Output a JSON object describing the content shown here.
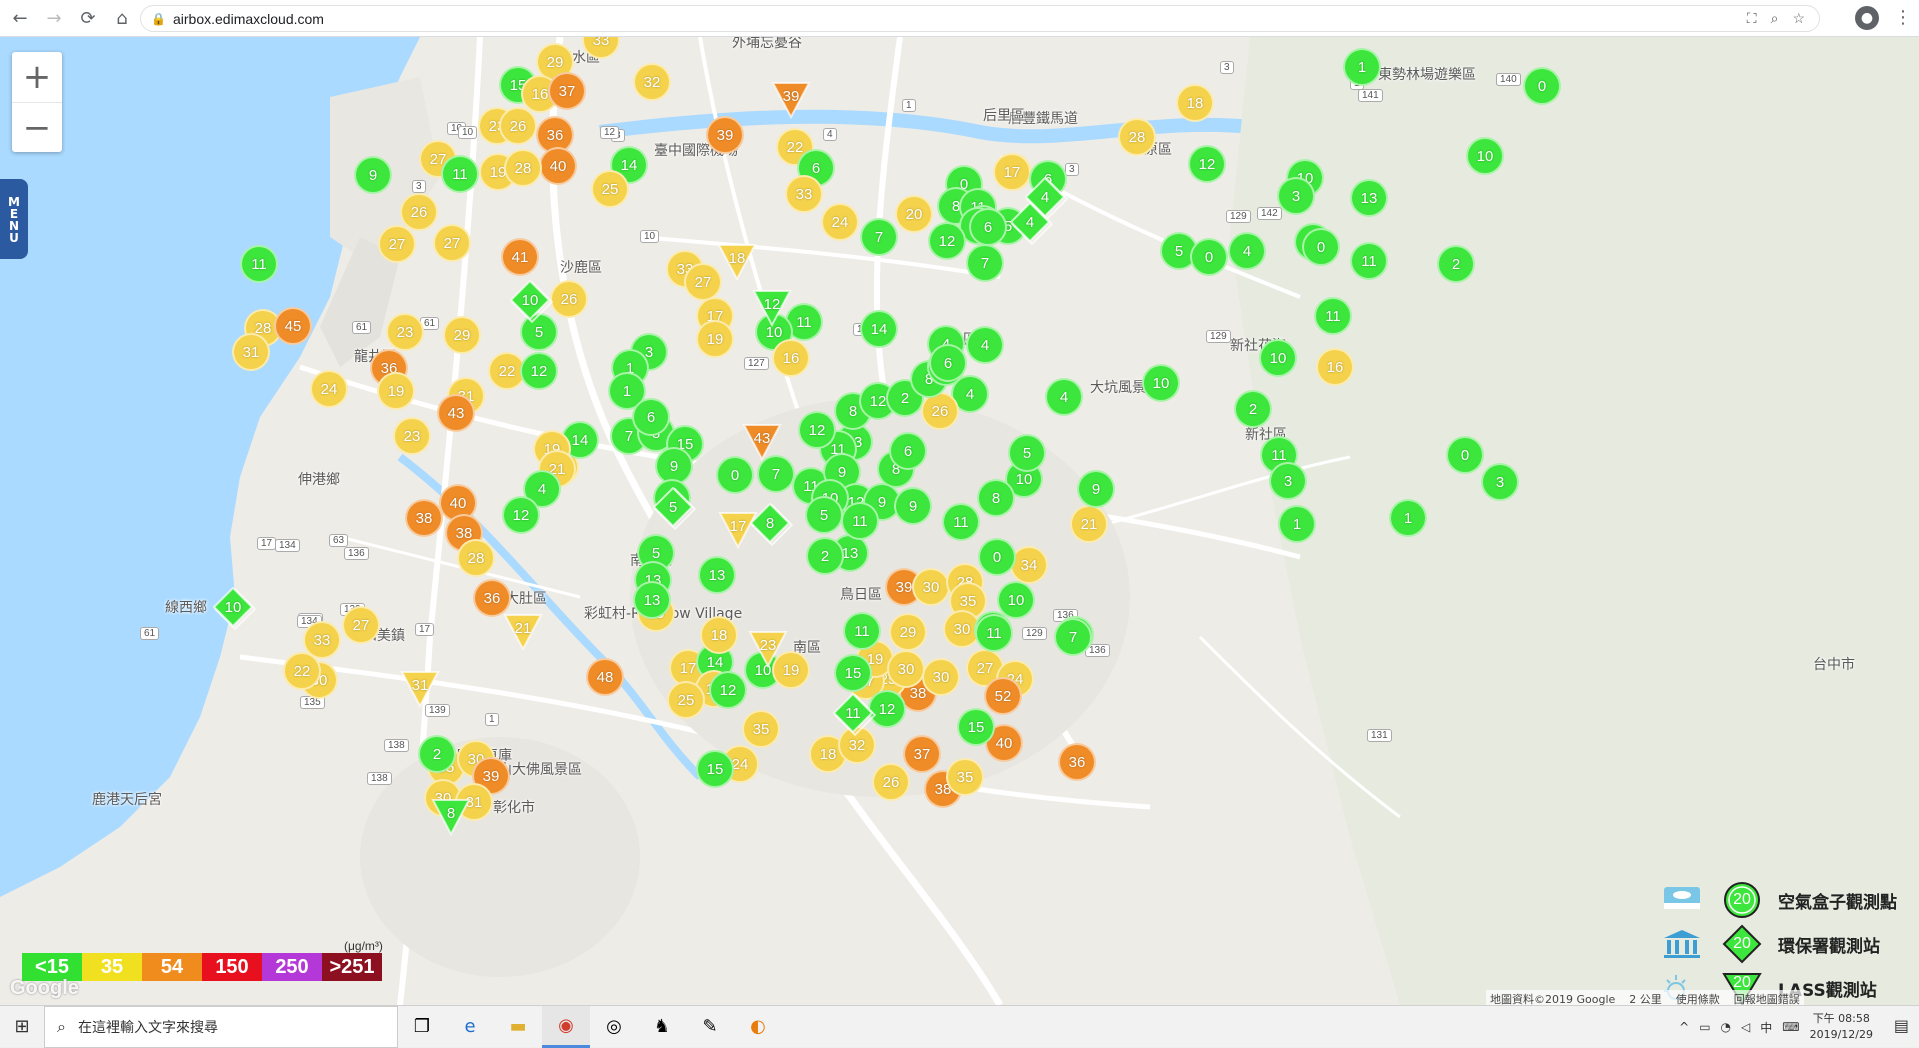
{
  "browser": {
    "url": "airbox.edimaxcloud.com",
    "back_icon": "back-arrow-icon",
    "forward_icon": "forward-arrow-icon",
    "reload_icon": "reload-icon",
    "home_icon": "home-icon"
  },
  "map": {
    "menu_label": "MENU",
    "zoom_in": "+",
    "zoom_out": "−",
    "place_labels": [
      {
        "text": "清水區"
      },
      {
        "text": "外埔忘憂谷"
      },
      {
        "text": "后豐鐵馬道"
      },
      {
        "text": "臺中國際機場"
      },
      {
        "text": "沙鹿區"
      },
      {
        "text": "龍井區"
      },
      {
        "text": "東勢林場遊樂區"
      },
      {
        "text": "新社花海"
      },
      {
        "text": "大坑風景區"
      },
      {
        "text": "新社區"
      },
      {
        "text": "線西鄉"
      },
      {
        "text": "彰化扇形車庫"
      },
      {
        "text": "八卦山大佛風景區"
      },
      {
        "text": "彰化市"
      },
      {
        "text": "鹿港天后宮"
      },
      {
        "text": "彩虹村-Rainbow Village"
      },
      {
        "text": "伸港鄉"
      },
      {
        "text": "和美鎮"
      },
      {
        "text": "大肚區"
      },
      {
        "text": "南屯區"
      },
      {
        "text": "鳥日區"
      },
      {
        "text": "豐原區"
      },
      {
        "text": "南區"
      },
      {
        "text": "北屯區"
      },
      {
        "text": "台中市"
      },
      {
        "text": "后里區"
      }
    ],
    "markers": [
      {
        "v": "33",
        "c": "yellow"
      },
      {
        "v": "29",
        "c": "yellow"
      },
      {
        "v": "15",
        "c": "green"
      },
      {
        "v": "16",
        "c": "yellow"
      },
      {
        "v": "37",
        "c": "orange"
      },
      {
        "v": "32",
        "c": "yellow"
      },
      {
        "v": "23",
        "c": "yellow"
      },
      {
        "v": "26",
        "c": "yellow"
      },
      {
        "v": "36",
        "c": "orange"
      },
      {
        "v": "40",
        "c": "orange"
      },
      {
        "v": "27",
        "c": "yellow"
      },
      {
        "v": "11",
        "c": "green"
      },
      {
        "v": "19",
        "c": "yellow"
      },
      {
        "v": "28",
        "c": "yellow"
      },
      {
        "v": "9",
        "c": "green"
      },
      {
        "v": "14",
        "c": "green"
      },
      {
        "v": "25",
        "c": "yellow"
      },
      {
        "v": "39",
        "c": "orange"
      },
      {
        "v": "22",
        "c": "yellow"
      },
      {
        "v": "6",
        "c": "green"
      },
      {
        "v": "33",
        "c": "yellow"
      },
      {
        "v": "24",
        "c": "yellow"
      },
      {
        "v": "20",
        "c": "yellow"
      },
      {
        "v": "7",
        "c": "green"
      },
      {
        "v": "26",
        "c": "yellow"
      },
      {
        "v": "27",
        "c": "yellow"
      },
      {
        "v": "27",
        "c": "yellow"
      },
      {
        "v": "11",
        "c": "green"
      },
      {
        "v": "41",
        "c": "orange"
      },
      {
        "v": "26",
        "c": "yellow"
      },
      {
        "v": "23",
        "c": "yellow"
      },
      {
        "v": "29",
        "c": "yellow"
      },
      {
        "v": "5",
        "c": "green"
      },
      {
        "v": "28",
        "c": "yellow"
      },
      {
        "v": "45",
        "c": "orange"
      },
      {
        "v": "31",
        "c": "yellow"
      },
      {
        "v": "36",
        "c": "orange"
      },
      {
        "v": "19",
        "c": "yellow"
      },
      {
        "v": "22",
        "c": "yellow"
      },
      {
        "v": "12",
        "c": "green"
      },
      {
        "v": "24",
        "c": "yellow"
      },
      {
        "v": "31",
        "c": "yellow"
      },
      {
        "v": "43",
        "c": "orange"
      },
      {
        "v": "23",
        "c": "yellow"
      },
      {
        "v": "33",
        "c": "yellow"
      },
      {
        "v": "27",
        "c": "yellow"
      },
      {
        "v": "18",
        "c": "yellow"
      },
      {
        "v": "33",
        "c": "yellow"
      },
      {
        "v": "17",
        "c": "yellow"
      },
      {
        "v": "19",
        "c": "yellow"
      },
      {
        "v": "21",
        "c": "yellow"
      },
      {
        "v": "11",
        "c": "green"
      },
      {
        "v": "10",
        "c": "green"
      },
      {
        "v": "16",
        "c": "yellow"
      },
      {
        "v": "3",
        "c": "green"
      },
      {
        "v": "1",
        "c": "green"
      },
      {
        "v": "1",
        "c": "green"
      },
      {
        "v": "14",
        "c": "green"
      },
      {
        "v": "7",
        "c": "green"
      },
      {
        "v": "8",
        "c": "green"
      },
      {
        "v": "6",
        "c": "green"
      },
      {
        "v": "15",
        "c": "green"
      },
      {
        "v": "9",
        "c": "green"
      },
      {
        "v": "19",
        "c": "yellow"
      },
      {
        "v": "21",
        "c": "yellow"
      },
      {
        "v": "4",
        "c": "green"
      },
      {
        "v": "12",
        "c": "green"
      },
      {
        "v": "9",
        "c": "green"
      },
      {
        "v": "40",
        "c": "orange"
      },
      {
        "v": "38",
        "c": "orange"
      },
      {
        "v": "38",
        "c": "orange"
      },
      {
        "v": "28",
        "c": "yellow"
      },
      {
        "v": "36",
        "c": "orange"
      },
      {
        "v": "33",
        "c": "yellow"
      },
      {
        "v": "27",
        "c": "yellow"
      },
      {
        "v": "17",
        "c": "yellow"
      },
      {
        "v": "30",
        "c": "yellow"
      },
      {
        "v": "48",
        "c": "orange"
      },
      {
        "v": "5",
        "c": "green"
      },
      {
        "v": "13",
        "c": "green"
      },
      {
        "v": "25",
        "c": "yellow"
      },
      {
        "v": "13",
        "c": "green"
      },
      {
        "v": "17",
        "c": "yellow"
      },
      {
        "v": "14",
        "c": "green"
      },
      {
        "v": "18",
        "c": "yellow"
      },
      {
        "v": "19",
        "c": "yellow"
      },
      {
        "v": "25",
        "c": "yellow"
      },
      {
        "v": "12",
        "c": "green"
      },
      {
        "v": "10",
        "c": "green"
      },
      {
        "v": "19",
        "c": "yellow"
      },
      {
        "v": "35",
        "c": "yellow"
      },
      {
        "v": "24",
        "c": "yellow"
      },
      {
        "v": "15",
        "c": "green"
      },
      {
        "v": "18",
        "c": "yellow"
      },
      {
        "v": "32",
        "c": "yellow"
      },
      {
        "v": "26",
        "c": "yellow"
      },
      {
        "v": "38",
        "c": "orange"
      },
      {
        "v": "35",
        "c": "yellow"
      },
      {
        "v": "37",
        "c": "orange"
      },
      {
        "v": "40",
        "c": "orange"
      },
      {
        "v": "15",
        "c": "green"
      },
      {
        "v": "36",
        "c": "orange"
      },
      {
        "v": "27",
        "c": "yellow"
      },
      {
        "v": "24",
        "c": "yellow"
      },
      {
        "v": "52",
        "c": "orange"
      },
      {
        "v": "38",
        "c": "orange"
      },
      {
        "v": "30",
        "c": "yellow"
      },
      {
        "v": "25",
        "c": "yellow"
      },
      {
        "v": "17",
        "c": "yellow"
      },
      {
        "v": "12",
        "c": "green"
      },
      {
        "v": "19",
        "c": "yellow"
      },
      {
        "v": "30",
        "c": "yellow"
      },
      {
        "v": "29",
        "c": "yellow"
      },
      {
        "v": "39",
        "c": "orange"
      },
      {
        "v": "30",
        "c": "yellow"
      },
      {
        "v": "28",
        "c": "yellow"
      },
      {
        "v": "35",
        "c": "yellow"
      },
      {
        "v": "30",
        "c": "yellow"
      },
      {
        "v": "13",
        "c": "green"
      },
      {
        "v": "11",
        "c": "green"
      },
      {
        "v": "10",
        "c": "green"
      },
      {
        "v": "7",
        "c": "green"
      },
      {
        "v": "34",
        "c": "yellow"
      },
      {
        "v": "0",
        "c": "green"
      },
      {
        "v": "21",
        "c": "yellow"
      },
      {
        "v": "9",
        "c": "green"
      },
      {
        "v": "10",
        "c": "green"
      },
      {
        "v": "5",
        "c": "green"
      },
      {
        "v": "8",
        "c": "green"
      },
      {
        "v": "11",
        "c": "green"
      },
      {
        "v": "4",
        "c": "green"
      },
      {
        "v": "13",
        "c": "green"
      },
      {
        "v": "11",
        "c": "green"
      },
      {
        "v": "8",
        "c": "green"
      },
      {
        "v": "12",
        "c": "green"
      },
      {
        "v": "2",
        "c": "green"
      },
      {
        "v": "26",
        "c": "yellow"
      },
      {
        "v": "8",
        "c": "green"
      },
      {
        "v": "4",
        "c": "green"
      },
      {
        "v": "4",
        "c": "green"
      },
      {
        "v": "6",
        "c": "green"
      },
      {
        "v": "4",
        "c": "green"
      },
      {
        "v": "0",
        "c": "green"
      },
      {
        "v": "8",
        "c": "green"
      },
      {
        "v": "11",
        "c": "green"
      },
      {
        "v": "10",
        "c": "green"
      },
      {
        "v": "4",
        "c": "green"
      },
      {
        "v": "5",
        "c": "green"
      },
      {
        "v": "6",
        "c": "green"
      },
      {
        "v": "12",
        "c": "green"
      },
      {
        "v": "7",
        "c": "green"
      },
      {
        "v": "17",
        "c": "yellow"
      },
      {
        "v": "6",
        "c": "green"
      },
      {
        "v": "14",
        "c": "green"
      },
      {
        "v": "28",
        "c": "yellow"
      },
      {
        "v": "18",
        "c": "yellow"
      },
      {
        "v": "12",
        "c": "green"
      },
      {
        "v": "5",
        "c": "green"
      },
      {
        "v": "0",
        "c": "green"
      },
      {
        "v": "1",
        "c": "green"
      },
      {
        "v": "0",
        "c": "green"
      },
      {
        "v": "10",
        "c": "green"
      },
      {
        "v": "10",
        "c": "green"
      },
      {
        "v": "3",
        "c": "green"
      },
      {
        "v": "13",
        "c": "green"
      },
      {
        "v": "11",
        "c": "green"
      },
      {
        "v": "0",
        "c": "green"
      },
      {
        "v": "4",
        "c": "green"
      },
      {
        "v": "11",
        "c": "green"
      },
      {
        "v": "2",
        "c": "green"
      },
      {
        "v": "11",
        "c": "green"
      },
      {
        "v": "10",
        "c": "green"
      },
      {
        "v": "16",
        "c": "yellow"
      },
      {
        "v": "10",
        "c": "green"
      },
      {
        "v": "4",
        "c": "green"
      },
      {
        "v": "2",
        "c": "green"
      },
      {
        "v": "11",
        "c": "green"
      },
      {
        "v": "3",
        "c": "green"
      },
      {
        "v": "1",
        "c": "green"
      },
      {
        "v": "0",
        "c": "green"
      },
      {
        "v": "3",
        "c": "green"
      },
      {
        "v": "1",
        "c": "green"
      },
      {
        "v": "11",
        "c": "green"
      },
      {
        "v": "15",
        "c": "green"
      },
      {
        "v": "7",
        "c": "green"
      },
      {
        "v": "11",
        "c": "green"
      },
      {
        "v": "9",
        "c": "green"
      },
      {
        "v": "12",
        "c": "green"
      },
      {
        "v": "8",
        "c": "green"
      },
      {
        "v": "6",
        "c": "green"
      },
      {
        "v": "9",
        "c": "green"
      },
      {
        "v": "13",
        "c": "green"
      },
      {
        "v": "11",
        "c": "green"
      },
      {
        "v": "10",
        "c": "green"
      },
      {
        "v": "5",
        "c": "green"
      },
      {
        "v": "0",
        "c": "green"
      },
      {
        "v": "7",
        "c": "green"
      },
      {
        "v": "12",
        "c": "green"
      },
      {
        "v": "2",
        "c": "green"
      },
      {
        "v": "9",
        "c": "green"
      },
      {
        "v": "35",
        "c": "yellow"
      },
      {
        "v": "30",
        "c": "yellow"
      },
      {
        "v": "39",
        "c": "orange"
      },
      {
        "v": "30",
        "c": "yellow"
      },
      {
        "v": "31",
        "c": "yellow"
      },
      {
        "v": "2",
        "c": "green"
      },
      {
        "v": "22",
        "c": "yellow"
      },
      {
        "v": "13",
        "c": "green"
      }
    ],
    "diamonds": [
      {
        "v": "10",
        "c": "green"
      },
      {
        "v": "5",
        "c": "green"
      },
      {
        "v": "10",
        "c": "green"
      },
      {
        "v": "4",
        "c": "green"
      },
      {
        "v": "4",
        "c": "green"
      },
      {
        "v": "11",
        "c": "green"
      },
      {
        "v": "8",
        "c": "green"
      }
    ],
    "triangles": [
      {
        "v": "39",
        "c": "orange"
      },
      {
        "v": "18",
        "c": "yellow"
      },
      {
        "v": "12",
        "c": "green"
      },
      {
        "v": "43",
        "c": "orange"
      },
      {
        "v": "17",
        "c": "yellow"
      },
      {
        "v": "21",
        "c": "yellow"
      },
      {
        "v": "31",
        "c": "yellow"
      },
      {
        "v": "23",
        "c": "yellow"
      },
      {
        "v": "8",
        "c": "green"
      }
    ],
    "road_shields": [
      "10",
      "3",
      "3",
      "1",
      "4",
      "61",
      "17",
      "134",
      "136",
      "139",
      "17",
      "61",
      "61",
      "63",
      "1",
      "134",
      "139",
      "138",
      "138",
      "135",
      "139",
      "140",
      "141",
      "142",
      "127",
      "129",
      "129",
      "136",
      "136",
      "131",
      "129",
      "140",
      "1",
      "1",
      "3",
      "3",
      "10",
      "10",
      "12"
    ],
    "scale": {
      "unit": "(μg/m³)",
      "items": [
        {
          "label": "<15",
          "color": "#32e032"
        },
        {
          "label": "35",
          "color": "#f0e020"
        },
        {
          "label": "54",
          "color": "#f08c1e"
        },
        {
          "label": "150",
          "color": "#e8101e"
        },
        {
          "label": "250",
          "color": "#b438d8"
        },
        {
          "label": ">251",
          "color": "#8c1020"
        }
      ]
    },
    "legend": {
      "items": [
        {
          "badge": "20",
          "label": "空氣盒子觀測點",
          "icon": "cloud-box-icon"
        },
        {
          "badge": "20",
          "label": "環保署觀測站",
          "icon": "government-building-icon"
        },
        {
          "badge": "20",
          "label": "LASS觀測站",
          "icon": "sun-station-icon"
        }
      ]
    },
    "footer": {
      "attribution": "地圖資料©2019 Google",
      "scale": "2 公里",
      "terms": "使用條款",
      "report": "回報地圖錯誤"
    },
    "google_logo": "Google",
    "colors": {
      "green": "#3ce63c",
      "yellow": "#f5d24b",
      "orange": "#f08c28",
      "water": "#aadaff"
    }
  },
  "taskbar": {
    "search_placeholder": "在這裡輸入文字來搜尋",
    "time": "下午 08:58",
    "date": "2019/12/29",
    "ime": "中"
  }
}
